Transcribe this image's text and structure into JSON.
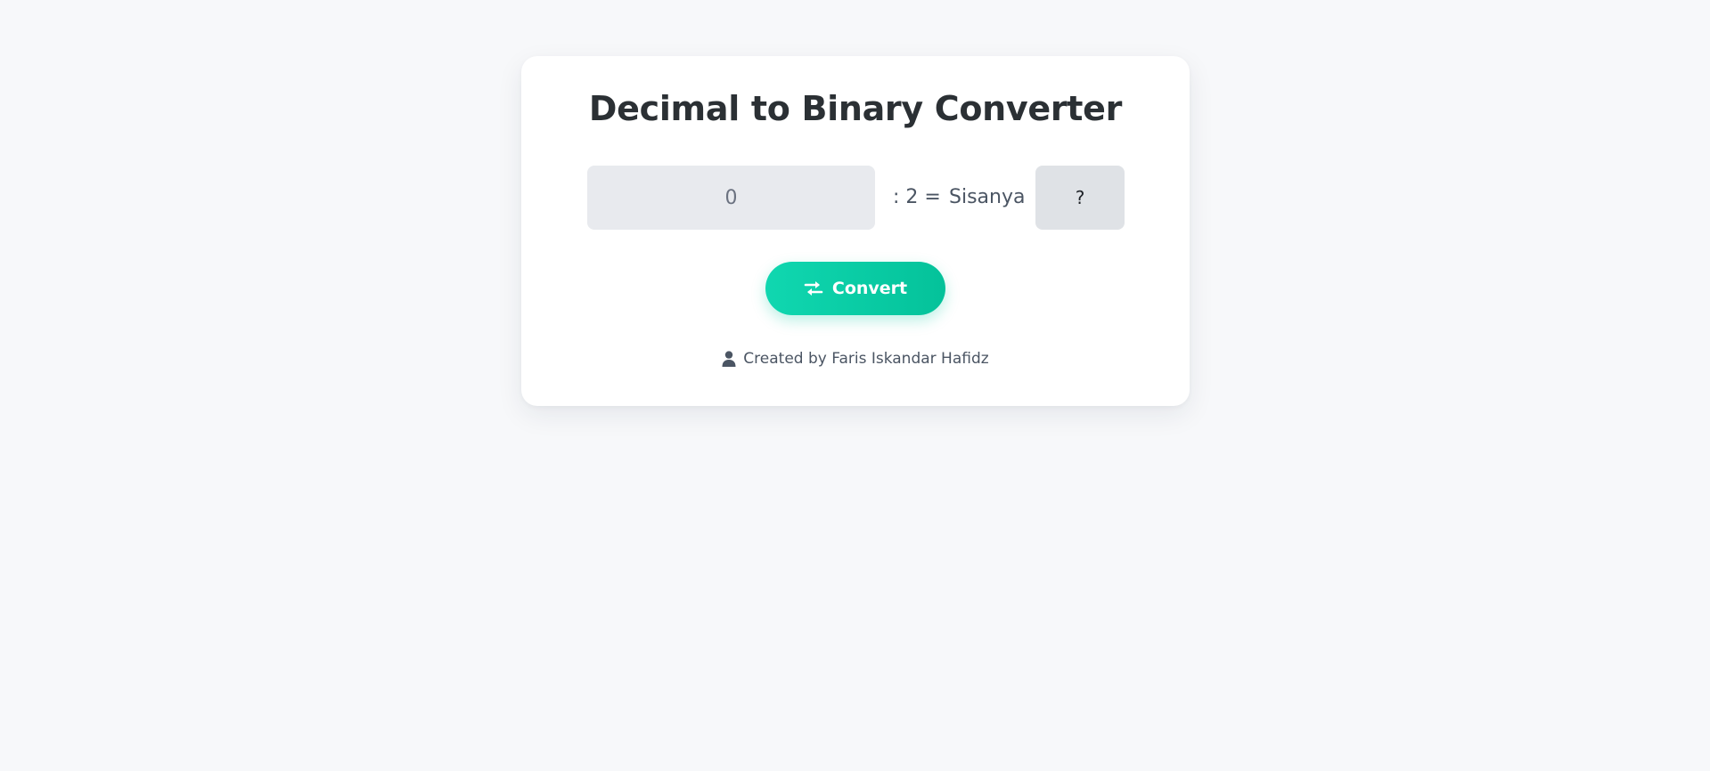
{
  "title": "Decimal to Binary Converter",
  "converter": {
    "decimal_placeholder": "0",
    "operator_text": ": 2 =",
    "remainder_label": "Sisanya",
    "remainder_value": "?"
  },
  "convert_button": {
    "label": "Convert",
    "icon": "swap-arrows-icon"
  },
  "footer": {
    "icon": "user-icon",
    "text": "Created by Faris Iskandar Hafidz"
  },
  "colors": {
    "background": "#f7f8fa",
    "card": "#ffffff",
    "accent_start": "#10d7b0",
    "accent_end": "#04c29a",
    "input_bg": "#e8eaee",
    "result_bg": "#dfe2e6",
    "title_text": "#2b3034"
  }
}
